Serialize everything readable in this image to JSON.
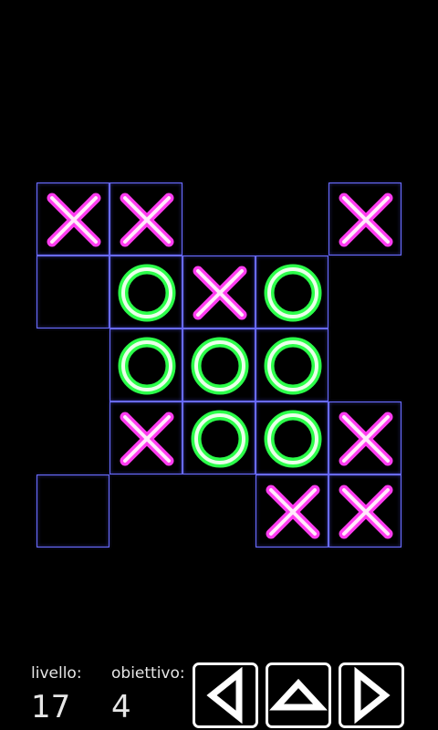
{
  "colors": {
    "background": "#000000",
    "grid_line": "#6a6cff",
    "x_mark": "#ff3cf0",
    "o_mark": "#2cff4a",
    "text": "#e6e6e6"
  },
  "board": {
    "rows": [
      [
        "X",
        "X",
        null,
        null,
        "X"
      ],
      [
        "",
        "O",
        "X",
        "O",
        null
      ],
      [
        null,
        "O",
        "O",
        "O",
        null
      ],
      [
        null,
        "X",
        "O",
        "O",
        "X"
      ],
      [
        "",
        null,
        null,
        "X",
        "X"
      ]
    ]
  },
  "hud": {
    "level_label": "livello:",
    "level_value": "17",
    "goal_label": "obiettivo:",
    "goal_value": "4"
  },
  "controls": [
    {
      "name": "left-arrow-button",
      "icon": "left-triangle-icon"
    },
    {
      "name": "up-arrow-button",
      "icon": "up-triangle-icon"
    },
    {
      "name": "right-arrow-button",
      "icon": "right-triangle-icon"
    }
  ]
}
